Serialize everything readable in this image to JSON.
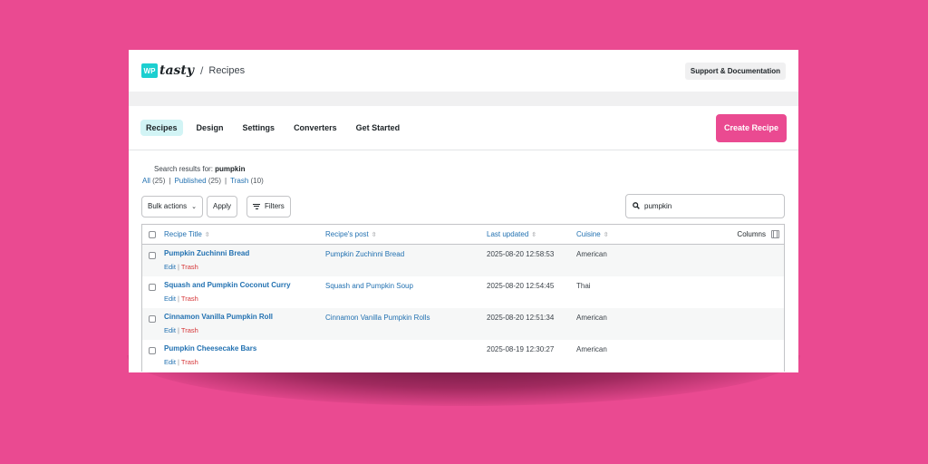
{
  "header": {
    "logo_wp": "WP",
    "logo_tasty": "tasty",
    "separator": "/",
    "breadcrumb": "Recipes",
    "support_label": "Support & Documentation"
  },
  "nav": {
    "tabs": [
      {
        "label": "Recipes",
        "active": true
      },
      {
        "label": "Design"
      },
      {
        "label": "Settings"
      },
      {
        "label": "Converters"
      },
      {
        "label": "Get Started"
      }
    ],
    "create_label": "Create Recipe"
  },
  "search_results": {
    "prefix": "Search results for:",
    "term": "pumpkin"
  },
  "status_filters": {
    "all": "All",
    "all_count": "(25)",
    "published": "Published",
    "published_count": "(25)",
    "trash": "Trash",
    "trash_count": "(10)",
    "sep": "|"
  },
  "toolbar": {
    "bulk_label": "Bulk actions",
    "chevron": "⌄",
    "apply_label": "Apply",
    "filters_label": "Filters",
    "search_value": "pumpkin"
  },
  "table": {
    "columns": {
      "title": "Recipe Title",
      "post": "Recipe's post",
      "updated": "Last updated",
      "cuisine": "Cuisine",
      "columns_btn": "Columns",
      "sort_glyph": "⇳"
    },
    "row_actions": {
      "edit": "Edit",
      "trash": "Trash",
      "sep": "|"
    },
    "rows": [
      {
        "title": "Pumpkin Zuchinni Bread",
        "post": "Pumpkin Zuchinni Bread",
        "updated": "2025-08-20 12:58:53",
        "cuisine": "American"
      },
      {
        "title": "Squash and Pumpkin Coconut Curry",
        "post": "Squash and Pumpkin Soup",
        "updated": "2025-08-20 12:54:45",
        "cuisine": "Thai"
      },
      {
        "title": "Cinnamon Vanilla Pumpkin Roll",
        "post": "Cinnamon Vanilla Pumpkin Rolls",
        "updated": "2025-08-20 12:51:34",
        "cuisine": "American"
      },
      {
        "title": "Pumpkin Cheesecake Bars",
        "post": "",
        "updated": "2025-08-19 12:30:27",
        "cuisine": "American"
      }
    ]
  },
  "colors": {
    "background": "#ea4a91",
    "accent": "#1ccfd0",
    "link": "#2271b1",
    "danger": "#d63638"
  }
}
